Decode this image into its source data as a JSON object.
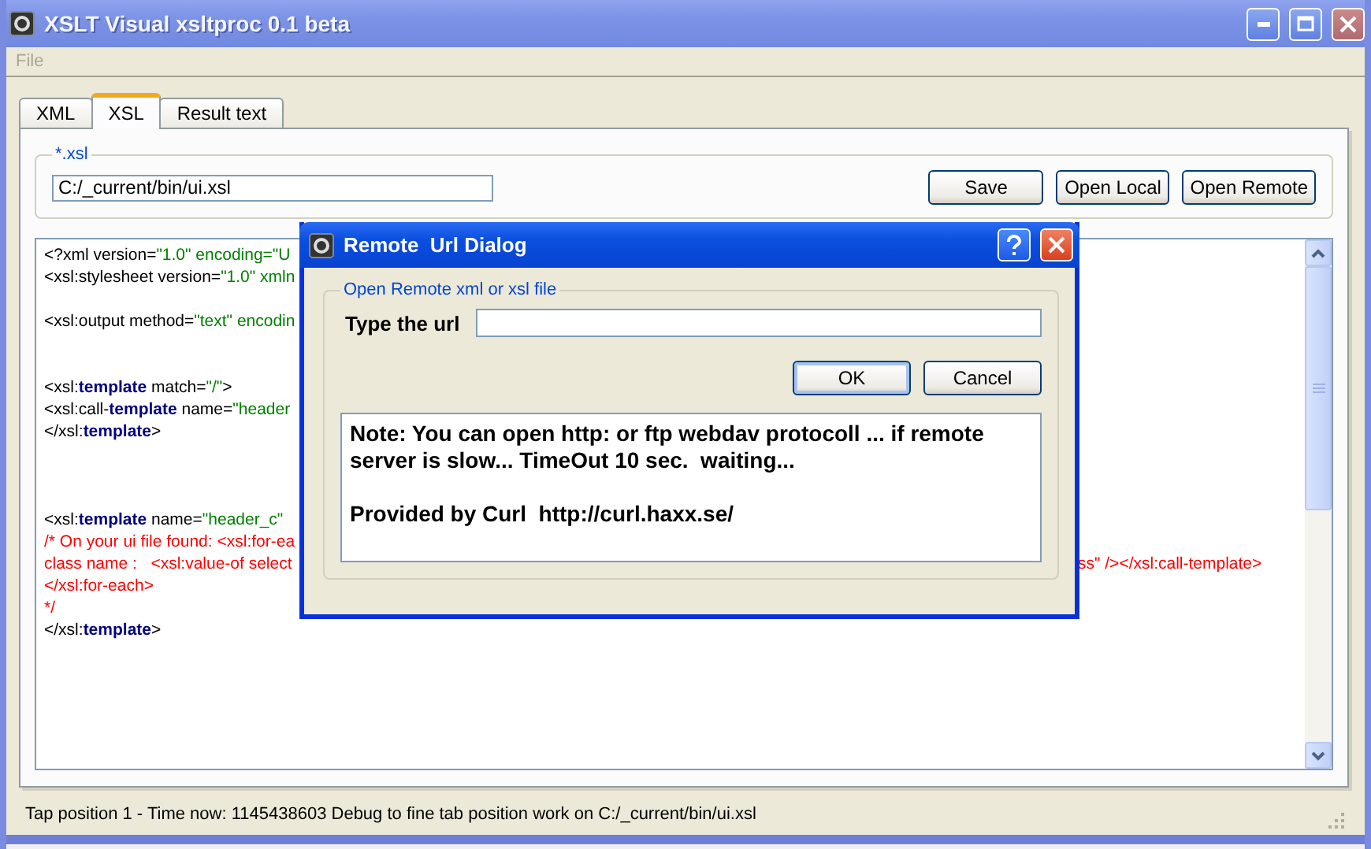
{
  "window": {
    "title": "XSLT Visual xsltproc 0.1 beta"
  },
  "menu": [
    {
      "label": "File",
      "disabled": true
    }
  ],
  "tabs": [
    {
      "label": "XML",
      "selected": false
    },
    {
      "label": "XSL",
      "selected": true
    },
    {
      "label": "Result text",
      "selected": false
    }
  ],
  "file_group": {
    "legend": "*.xsl",
    "path": "C:/_current/bin/ui.xsl",
    "buttons": [
      "Save",
      "Open Local",
      "Open Remote"
    ]
  },
  "editor": {
    "lines": [
      {
        "kind": "code",
        "segments": [
          {
            "kind": "plain",
            "text": "<?xml version="
          },
          {
            "kind": "string",
            "text": "\"1.0\" encoding=\"U"
          }
        ]
      },
      {
        "kind": "code",
        "segments": [
          {
            "kind": "plain",
            "text": "<xsl:stylesheet version="
          },
          {
            "kind": "string",
            "text": "\"1.0\" xmln"
          }
        ]
      },
      {
        "kind": "blank"
      },
      {
        "kind": "code",
        "segments": [
          {
            "kind": "plain",
            "text": "<xsl:output method="
          },
          {
            "kind": "string",
            "text": "\"text\" encodin"
          }
        ]
      },
      {
        "kind": "blank"
      },
      {
        "kind": "blank"
      },
      {
        "kind": "code",
        "segments": [
          {
            "kind": "plain",
            "text": "<xsl:"
          },
          {
            "kind": "keyword",
            "text": "template"
          },
          {
            "kind": "plain",
            "text": " match="
          },
          {
            "kind": "string",
            "text": "\"/\""
          },
          {
            "kind": "plain",
            "text": ">"
          }
        ]
      },
      {
        "kind": "code",
        "segments": [
          {
            "kind": "plain",
            "text": "<xsl:call-"
          },
          {
            "kind": "keyword",
            "text": "template"
          },
          {
            "kind": "plain",
            "text": " name="
          },
          {
            "kind": "string",
            "text": "\"header"
          }
        ]
      },
      {
        "kind": "code",
        "segments": [
          {
            "kind": "plain",
            "text": "</xsl:"
          },
          {
            "kind": "keyword",
            "text": "template"
          },
          {
            "kind": "plain",
            "text": ">"
          }
        ]
      },
      {
        "kind": "blank"
      },
      {
        "kind": "blank"
      },
      {
        "kind": "blank"
      },
      {
        "kind": "code",
        "segments": [
          {
            "kind": "plain",
            "text": "<xsl:"
          },
          {
            "kind": "keyword",
            "text": "template"
          },
          {
            "kind": "plain",
            "text": " name="
          },
          {
            "kind": "string",
            "text": "\"header_c\""
          }
        ]
      },
      {
        "kind": "code",
        "segments": [
          {
            "kind": "comment",
            "text": "/* On your ui file found: <xsl:for-ea"
          }
        ]
      },
      {
        "kind": "code",
        "segments": [
          {
            "kind": "comment",
            "text": "class name :   <xsl:value-of select"
          }
        ],
        "tail": [
          {
            "kind": "comment",
            "text": "ss\" /></xsl:call-template>"
          }
        ]
      },
      {
        "kind": "code",
        "segments": [
          {
            "kind": "comment",
            "text": "</xsl:for-each>"
          }
        ]
      },
      {
        "kind": "code",
        "segments": [
          {
            "kind": "comment",
            "text": "*/"
          }
        ]
      },
      {
        "kind": "code",
        "segments": [
          {
            "kind": "plain",
            "text": "</xsl:"
          },
          {
            "kind": "keyword",
            "text": "template"
          },
          {
            "kind": "plain",
            "text": ">"
          }
        ]
      }
    ]
  },
  "dialog": {
    "title": "Remote  Url Dialog",
    "legend": "Open Remote xml or xsl file",
    "url_label": "Type the url",
    "buttons": [
      {
        "label": "OK",
        "default": true
      },
      {
        "label": "Cancel",
        "default": false
      }
    ],
    "note": [
      "Note: You can open http: or ftp webdav protocoll ... if remote server is slow... TimeOut 10 sec.  waiting...",
      "Provided by Curl  http://curl.haxx.se/"
    ]
  },
  "status_bar": "Tap position 1 - Time now: 1145438603 Debug to fine tab position work on C:/_current/bin/ui.xsl"
}
